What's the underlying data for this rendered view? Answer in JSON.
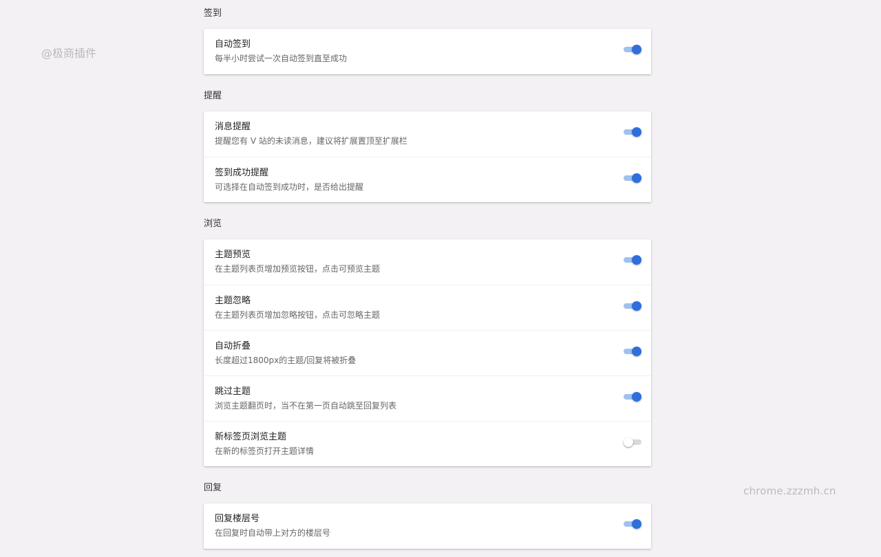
{
  "watermark_left": "@极商插件",
  "watermark_right": "chrome.zzzmh.cn",
  "sections": [
    {
      "title": "签到",
      "items": [
        {
          "title": "自动签到",
          "desc": "每半小时尝试一次自动签到直至成功",
          "enabled": true
        }
      ]
    },
    {
      "title": "提醒",
      "items": [
        {
          "title": "消息提醒",
          "desc": "提醒您有 V 站的未读消息，建议将扩展置顶至扩展栏",
          "enabled": true
        },
        {
          "title": "签到成功提醒",
          "desc": "可选择在自动签到成功时，是否给出提醒",
          "enabled": true
        }
      ]
    },
    {
      "title": "浏览",
      "items": [
        {
          "title": "主题预览",
          "desc": "在主题列表页增加预览按钮，点击可预览主题",
          "enabled": true
        },
        {
          "title": "主题忽略",
          "desc": "在主题列表页增加忽略按钮，点击可忽略主题",
          "enabled": true
        },
        {
          "title": "自动折叠",
          "desc": "长度超过1800px的主题/回复将被折叠",
          "enabled": true
        },
        {
          "title": "跳过主题",
          "desc": "浏览主题翻页时，当不在第一页自动跳至回复列表",
          "enabled": true
        },
        {
          "title": "新标签页浏览主题",
          "desc": "在新的标签页打开主题详情",
          "enabled": false
        }
      ]
    },
    {
      "title": "回复",
      "items": [
        {
          "title": "回复楼层号",
          "desc": "在回复时自动带上对方的楼层号",
          "enabled": true
        }
      ]
    }
  ],
  "colors": {
    "background": "#f4f1f4",
    "toggle_on_knob": "#2f6fdc",
    "toggle_on_track": "#9fc1f2",
    "toggle_off_track": "#d9d9d9",
    "toggle_off_knob": "#ffffff"
  }
}
